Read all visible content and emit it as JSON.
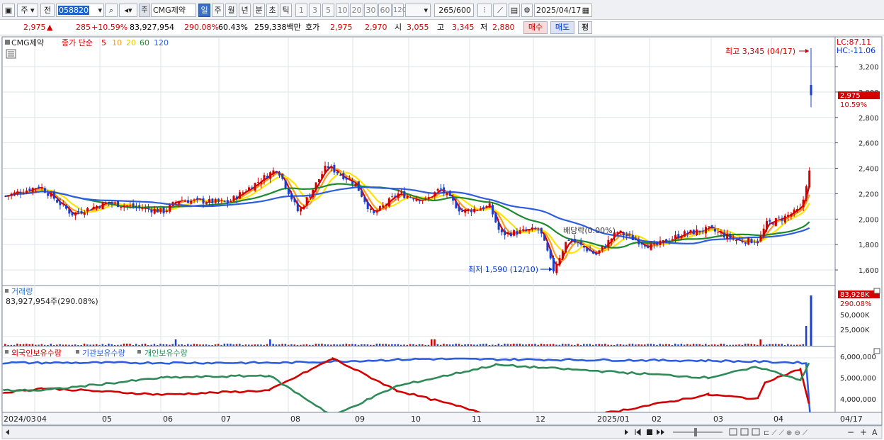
{
  "toolbar": {
    "type_label": "주",
    "prev_label": "전",
    "code": "058820",
    "stock_name": "CMG제약",
    "stock_marker": "주",
    "periods": [
      "일",
      "주",
      "월",
      "년",
      "분",
      "초",
      "틱"
    ],
    "active_period": "일",
    "intervals": [
      "1",
      "3",
      "5",
      "10",
      "20",
      "30",
      "60",
      "120"
    ],
    "count_value": "265",
    "count_total": "/600",
    "date": "2025/04/17"
  },
  "quote": {
    "price": "2,975",
    "change_arrow": "▲",
    "change": "285",
    "change_pct": "+10.59%",
    "volume": "83,927,954",
    "volume_ratio": "290.08%",
    "turnover": "60.43%",
    "amount": "259,338백만",
    "bid_label": "호가",
    "ask": "2,975",
    "bid": "2,970",
    "open_label": "시",
    "open": "3,055",
    "high_label": "고",
    "high": "3,345",
    "low_label": "저",
    "low": "2,880",
    "buy_label": "매수",
    "sell_label": "매도",
    "eval_label": "평"
  },
  "price_panel": {
    "legend_name": "CMG제약",
    "legend_ma_label": "종가 단순",
    "ma_periods": [
      "5",
      "10",
      "20",
      "60",
      "120"
    ],
    "ma_colors": [
      "#d40000",
      "#ff9a1a",
      "#ffe400",
      "#1e8a2e",
      "#2e5ee0"
    ],
    "lc_label": "LC:87.11",
    "hc_label": "HC:-11.06",
    "max_label": "최고 3,345 (04/17)",
    "min_label": "최저 1,590 (12/10)",
    "dividend_label": "배당락(0.00%)",
    "current_price_tag": "2,975",
    "current_pct_tag": "10.59%",
    "y_ticks": [
      "3,200",
      "3,000",
      "2,800",
      "2,600",
      "2,400",
      "2,200",
      "2,000",
      "1,800",
      "1,600"
    ]
  },
  "volume_panel": {
    "title": "거래량",
    "value_label": "83,927,954주(290.08%)",
    "current_tag": "83,928K",
    "current_pct": "290.08%",
    "y_ticks": [
      "50,000K",
      "25,000K"
    ]
  },
  "holding_panel": {
    "legend": [
      "외국인보유수량",
      "기관보유수량",
      "개인보유수량"
    ],
    "legend_colors": [
      "#d40000",
      "#2e5ee0",
      "#2e8b57"
    ],
    "y_ticks": [
      "6,000,000",
      "5,000,000",
      "4,000,000"
    ]
  },
  "x_axis": {
    "labels": [
      "2024/03",
      "04",
      "05",
      "06",
      "07",
      "08",
      "09",
      "10",
      "11",
      "12",
      "2025/01",
      "02",
      "03",
      "04"
    ],
    "end_label": "04/17"
  },
  "colors": {
    "up": "#d40000",
    "down": "#1a3fcf",
    "grid": "#dfe3ea",
    "panel_border": "#7d8698"
  }
}
